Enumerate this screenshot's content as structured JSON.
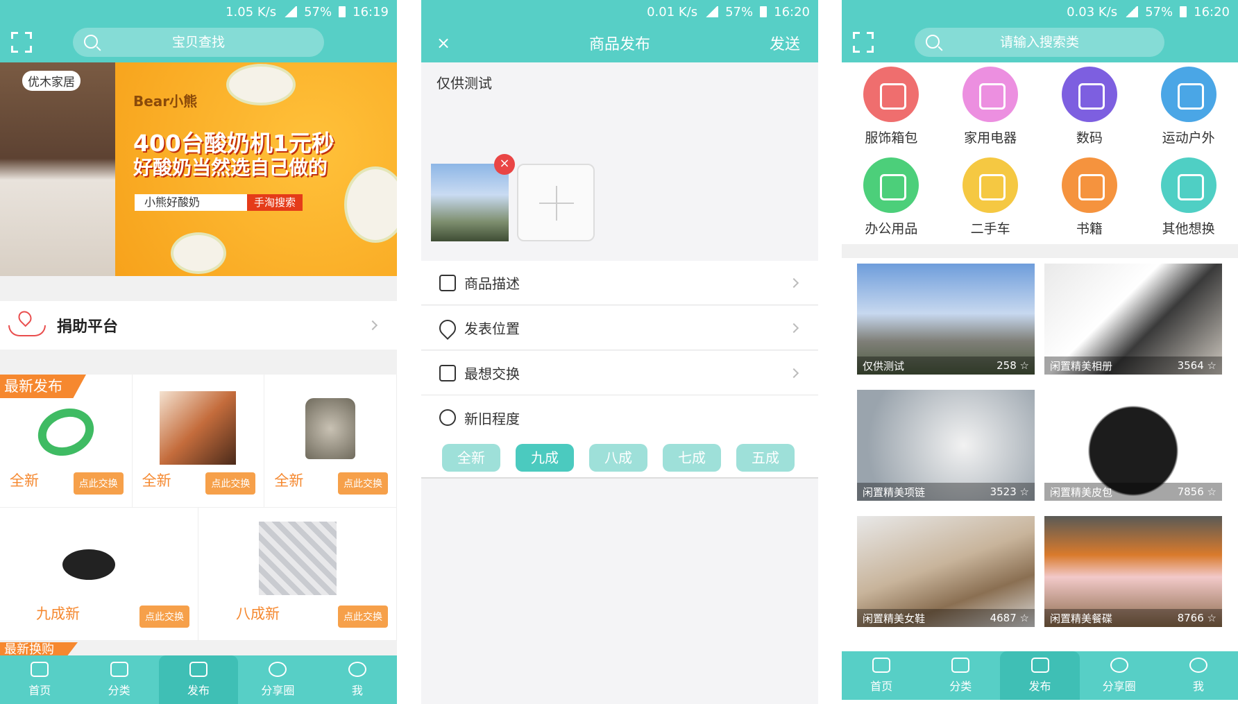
{
  "screens": {
    "home": {
      "status": {
        "speed": "1.05 K/s",
        "battery": "57%",
        "time": "16:19"
      },
      "search_placeholder": "宝贝查找",
      "banner": {
        "brand": "优木家居",
        "ad_logo": "Bear小熊",
        "headline1": "400台酸奶机1元秒",
        "headline2": "好酸奶当然选自己做的",
        "search_text": "小熊好酸奶",
        "search_button": "手淘搜索"
      },
      "donate_label": "捐助平台",
      "latest_tag": "最新发布",
      "products": [
        {
          "cond": "全新",
          "swap": "点此交换",
          "icon": "bangle"
        },
        {
          "cond": "全新",
          "swap": "点此交换",
          "icon": "shoes"
        },
        {
          "cond": "全新",
          "swap": "点此交换",
          "icon": "jacket"
        },
        {
          "cond": "九成新",
          "swap": "点此交换",
          "icon": "pan"
        },
        {
          "cond": "八成新",
          "swap": "点此交换",
          "icon": "bowls"
        }
      ],
      "next_tag": "最新换购",
      "tabs": [
        "首页",
        "分类",
        "发布",
        "分享圈",
        "我"
      ],
      "colors": {
        "primary": "#57cfc6",
        "accent": "#f6882f"
      }
    },
    "publish": {
      "status": {
        "speed": "0.01 K/s",
        "battery": "57%",
        "time": "16:20"
      },
      "title": "商品发布",
      "send": "发送",
      "text": "仅供测试",
      "rows": [
        "商品描述",
        "发表位置",
        "最想交换",
        "新旧程度"
      ],
      "conditions": [
        "全新",
        "九成",
        "八成",
        "七成",
        "五成"
      ],
      "selected_condition": "九成"
    },
    "category": {
      "status": {
        "speed": "0.03 K/s",
        "battery": "57%",
        "time": "16:20"
      },
      "search_placeholder": "请输入搜索类",
      "categories": [
        {
          "name": "服饰箱包",
          "color": "#ef6e6e",
          "icon": "shirt-icon"
        },
        {
          "name": "家用电器",
          "color": "#ec8fe0",
          "icon": "lamp-icon"
        },
        {
          "name": "数码",
          "color": "#7d5fe0",
          "icon": "camera-icon"
        },
        {
          "name": "运动户外",
          "color": "#4aa6e6",
          "icon": "bike-icon"
        },
        {
          "name": "办公用品",
          "color": "#4ccf7a",
          "icon": "document-icon"
        },
        {
          "name": "二手车",
          "color": "#f5c842",
          "icon": "car-icon"
        },
        {
          "name": "书籍",
          "color": "#f5933e",
          "icon": "book-icon"
        },
        {
          "name": "其他想换",
          "color": "#4fcfc4",
          "icon": "more-icon"
        }
      ],
      "items": [
        {
          "title": "仅供测试",
          "likes": "258"
        },
        {
          "title": "闲置精美相册",
          "likes": "3564"
        },
        {
          "title": "闲置精美项链",
          "likes": "3523"
        },
        {
          "title": "闲置精美皮包",
          "likes": "7856"
        },
        {
          "title": "闲置精美女鞋",
          "likes": "4687"
        },
        {
          "title": "闲置精美餐碟",
          "likes": "8766"
        }
      ],
      "tabs": [
        "首页",
        "分类",
        "发布",
        "分享圈",
        "我"
      ]
    }
  }
}
